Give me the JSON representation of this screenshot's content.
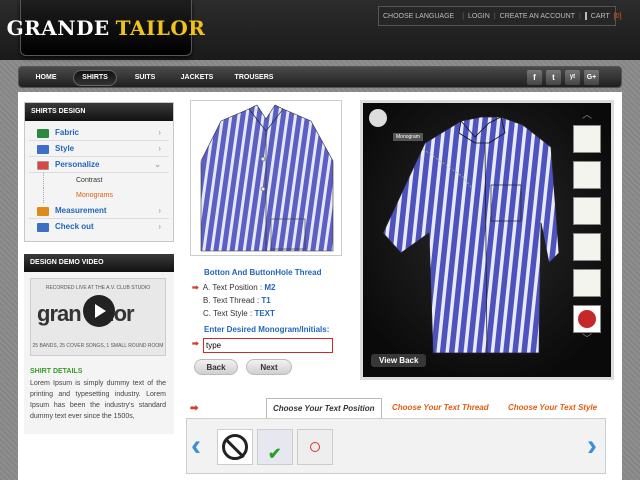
{
  "brand": {
    "word1": "GRANDE",
    "word2": "TAILOR"
  },
  "topbar": {
    "choose_language": "CHOOSE LANGUAGE",
    "login": "LOGIN",
    "create_account": "CREATE AN ACCOUNT",
    "cart": "CART",
    "cart_count": "[0]"
  },
  "nav": {
    "items": [
      {
        "label": "HOME"
      },
      {
        "label": "SHIRTS"
      },
      {
        "label": "SUITS"
      },
      {
        "label": "JACKETS"
      },
      {
        "label": "TROUSERS"
      }
    ],
    "active": "SHIRTS",
    "social": [
      "f",
      "t",
      "yt",
      "G+"
    ]
  },
  "sidebar": {
    "title": "SHIRTS DESIGN",
    "items": [
      {
        "label": "Fabric"
      },
      {
        "label": "Style"
      },
      {
        "label": "Personalize"
      },
      {
        "label": "Measurement"
      },
      {
        "label": "Check out"
      }
    ],
    "sub_items": [
      {
        "label": "Contrast"
      },
      {
        "label": "Monograms"
      }
    ]
  },
  "video": {
    "title": "DESIGN DEMO VIDEO",
    "line1": "RECORDED LIVE AT THE A.V. CLUB STUDIO",
    "word": "gran  tailor",
    "line2": "25 BANDS, 25 COVER SONGS, 1 SMALL ROUND ROOM"
  },
  "details": {
    "title": "SHIRT DETAILS",
    "text": "Lorem Ipsum is simply dummy text of the printing and typesetting industry. Lorem Ipsum has been the industry's standard dummy text ever since the 1500s,"
  },
  "thread": {
    "title": "Botton And ButtonHole Thread",
    "options": [
      {
        "label": "A. Text Position : ",
        "value": "M2"
      },
      {
        "label": "B. Text Thread : ",
        "value": "T1"
      },
      {
        "label": "C. Text Style : ",
        "value": "TEXT"
      }
    ],
    "mono_label": "Enter Desired Monogram/Initials:",
    "mono_value": "type",
    "back": "Back",
    "next": "Next"
  },
  "viewer": {
    "view_back": "View Back",
    "callout": "Monogram"
  },
  "tabs": [
    {
      "label": "Choose Your Text Position"
    },
    {
      "label": "Choose Your Text Thread"
    },
    {
      "label": "Choose Your Text Style"
    }
  ],
  "colors": {
    "accent_blue": "#2266bb",
    "orange": "#e25d12",
    "gold": "#f0c21b",
    "green": "#3a9a2a"
  }
}
